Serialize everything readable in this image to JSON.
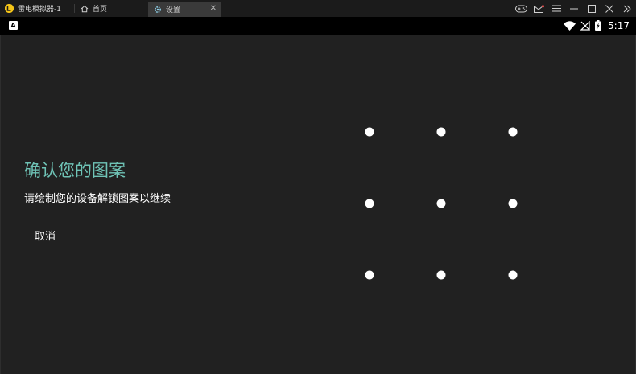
{
  "window": {
    "app_title": "雷电模拟器-1",
    "tabs": [
      {
        "label": "首页",
        "icon": "home-icon"
      },
      {
        "label": "设置",
        "icon": "settings-gear-icon",
        "active": true
      }
    ]
  },
  "statusbar": {
    "keyboard_badge": "A",
    "time": "5:17"
  },
  "screen": {
    "title": "确认您的图案",
    "subtitle": "请绘制您的设备解锁图案以继续",
    "cancel_label": "取消"
  },
  "pattern": {
    "rows": 3,
    "cols": 3
  },
  "colors": {
    "background": "#212121",
    "title": "#6fc3b6",
    "text": "#ffffff",
    "titlebar": "#1b1b1b",
    "active_tab": "#3a3a3a"
  }
}
